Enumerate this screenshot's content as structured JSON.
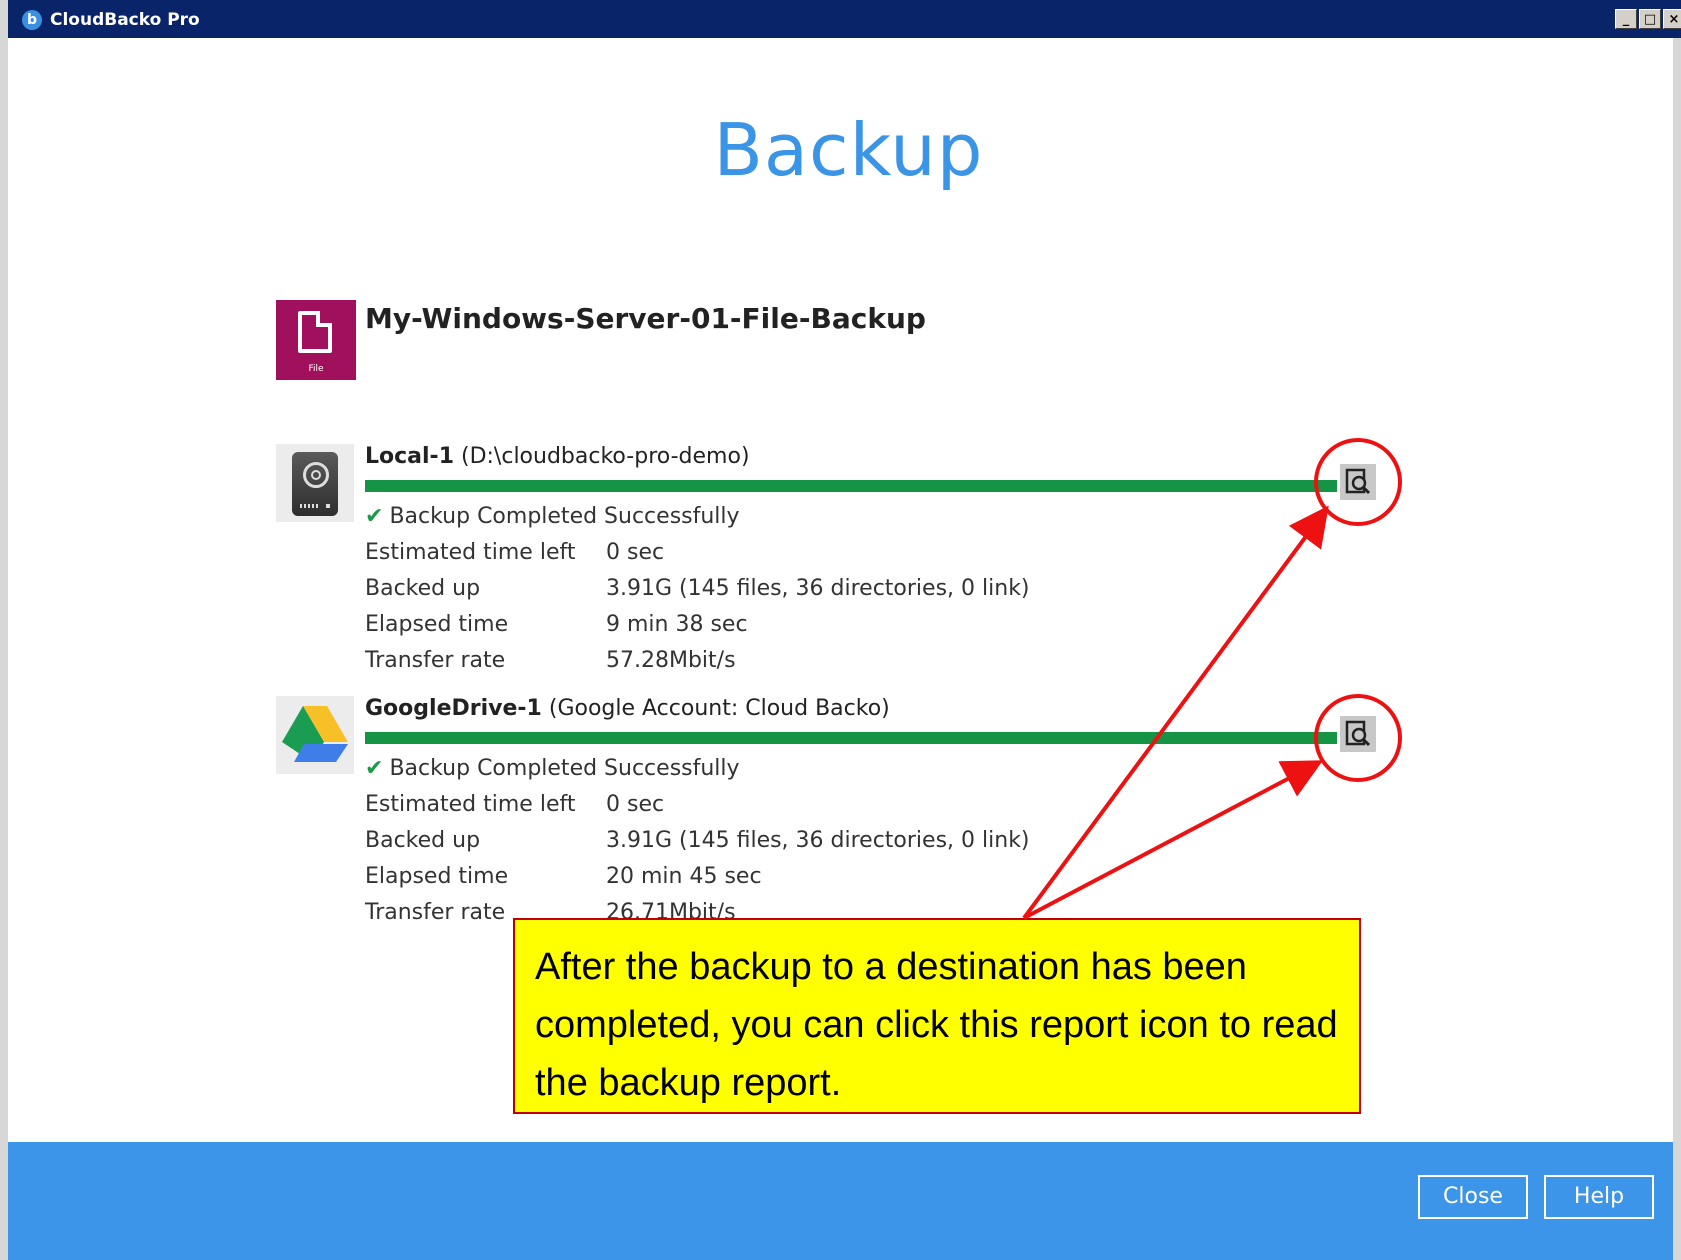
{
  "window": {
    "title": "CloudBacko Pro",
    "controls": [
      "_",
      "□",
      "×"
    ]
  },
  "page": {
    "heading": "Backup"
  },
  "backup_set": {
    "name": "My-Windows-Server-01-File-Backup",
    "icon_label": "File",
    "icon_color": "#a1105c"
  },
  "destinations": [
    {
      "name": "Local-1",
      "detail": "(D:\\cloudbacko-pro-demo)",
      "icon": "hard-drive-icon",
      "progress": 1.0,
      "status": "Backup Completed Successfully",
      "rows": [
        {
          "label": "Estimated time left",
          "value": "0 sec"
        },
        {
          "label": "Backed up",
          "value": "3.91G (145 files, 36 directories, 0 link)"
        },
        {
          "label": "Elapsed time",
          "value": "9 min 38 sec"
        },
        {
          "label": "Transfer rate",
          "value": "57.28Mbit/s"
        }
      ]
    },
    {
      "name": "GoogleDrive-1",
      "detail": "(Google Account: Cloud Backo)",
      "icon": "google-drive-icon",
      "progress": 1.0,
      "status": "Backup Completed Successfully",
      "rows": [
        {
          "label": "Estimated time left",
          "value": "0 sec"
        },
        {
          "label": "Backed up",
          "value": "3.91G (145 files, 36 directories, 0 link)"
        },
        {
          "label": "Elapsed time",
          "value": "20 min 45 sec"
        },
        {
          "label": "Transfer rate",
          "value": "26.71Mbit/s"
        }
      ]
    }
  ],
  "footer": {
    "close_label": "Close",
    "help_label": "Help"
  },
  "annotation": {
    "text": "After the backup to a destination has been completed, you can click this report icon to read the backup report."
  },
  "colors": {
    "accent": "#3c95e8",
    "progress": "#159446",
    "annotation_red": "#ee1111",
    "callout_bg": "#ffff00"
  }
}
